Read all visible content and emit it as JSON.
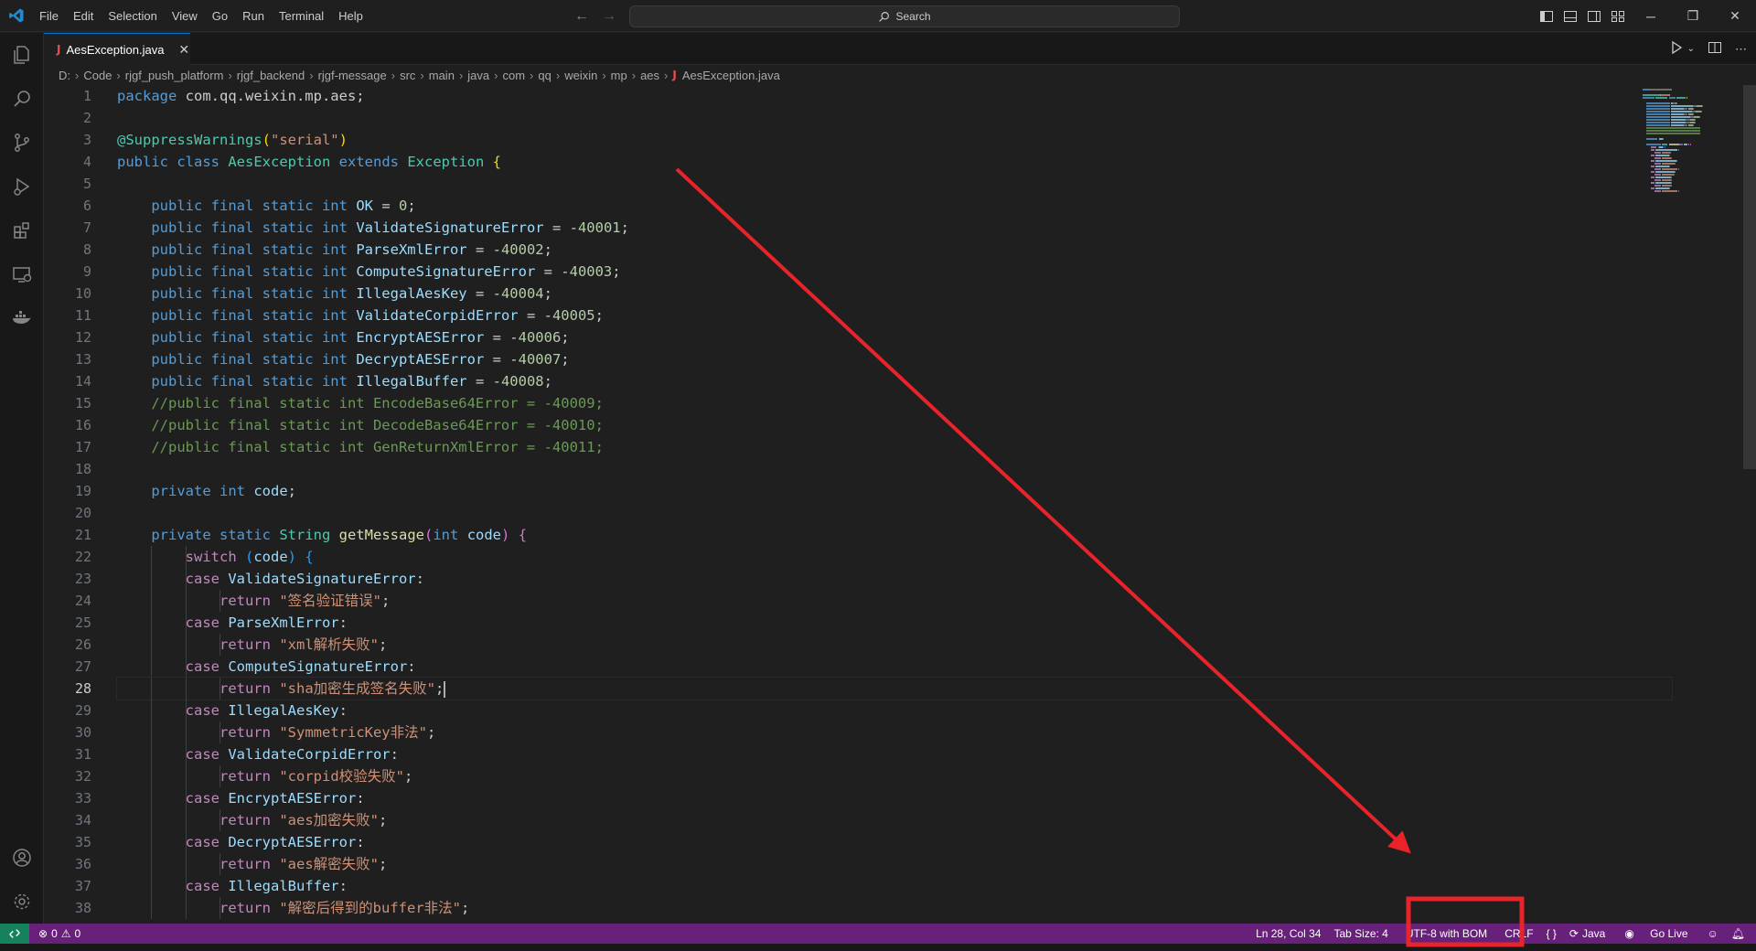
{
  "titlebar": {
    "menu": [
      "File",
      "Edit",
      "Selection",
      "View",
      "Go",
      "Run",
      "Terminal",
      "Help"
    ],
    "search_label": "Search"
  },
  "tab": {
    "icon_letter": "J",
    "filename": "AesException.java",
    "close": "✕"
  },
  "breadcrumb": {
    "items": [
      "D:",
      "Code",
      "rjgf_push_platform",
      "rjgf_backend",
      "rjgf-message",
      "src",
      "main",
      "java",
      "com",
      "qq",
      "weixin",
      "mp",
      "aes"
    ],
    "file": "AesException.java"
  },
  "editor": {
    "current_line": 28,
    "code": [
      [
        [
          "kw",
          "package"
        ],
        [
          "plain",
          " com.qq.weixin.mp.aes;"
        ]
      ],
      [],
      [
        [
          "ty",
          "@SuppressWarnings"
        ],
        [
          "br1",
          "("
        ],
        [
          "str",
          "\"serial\""
        ],
        [
          "br1",
          ")"
        ]
      ],
      [
        [
          "kw",
          "public class"
        ],
        [
          "plain",
          " "
        ],
        [
          "ty",
          "AesException"
        ],
        [
          "plain",
          " "
        ],
        [
          "kw",
          "extends"
        ],
        [
          "plain",
          " "
        ],
        [
          "ty",
          "Exception"
        ],
        [
          "plain",
          " "
        ],
        [
          "br1",
          "{"
        ]
      ],
      [],
      [
        [
          "plain",
          "    "
        ],
        [
          "kw",
          "public final static int"
        ],
        [
          "plain",
          " "
        ],
        [
          "var",
          "OK"
        ],
        [
          "plain",
          " = "
        ],
        [
          "num",
          "0"
        ],
        [
          "plain",
          ";"
        ]
      ],
      [
        [
          "plain",
          "    "
        ],
        [
          "kw",
          "public final static int"
        ],
        [
          "plain",
          " "
        ],
        [
          "var",
          "ValidateSignatureError"
        ],
        [
          "plain",
          " = -"
        ],
        [
          "num",
          "40001"
        ],
        [
          "plain",
          ";"
        ]
      ],
      [
        [
          "plain",
          "    "
        ],
        [
          "kw",
          "public final static int"
        ],
        [
          "plain",
          " "
        ],
        [
          "var",
          "ParseXmlError"
        ],
        [
          "plain",
          " = -"
        ],
        [
          "num",
          "40002"
        ],
        [
          "plain",
          ";"
        ]
      ],
      [
        [
          "plain",
          "    "
        ],
        [
          "kw",
          "public final static int"
        ],
        [
          "plain",
          " "
        ],
        [
          "var",
          "ComputeSignatureError"
        ],
        [
          "plain",
          " = -"
        ],
        [
          "num",
          "40003"
        ],
        [
          "plain",
          ";"
        ]
      ],
      [
        [
          "plain",
          "    "
        ],
        [
          "kw",
          "public final static int"
        ],
        [
          "plain",
          " "
        ],
        [
          "var",
          "IllegalAesKey"
        ],
        [
          "plain",
          " = -"
        ],
        [
          "num",
          "40004"
        ],
        [
          "plain",
          ";"
        ]
      ],
      [
        [
          "plain",
          "    "
        ],
        [
          "kw",
          "public final static int"
        ],
        [
          "plain",
          " "
        ],
        [
          "var",
          "ValidateCorpidError"
        ],
        [
          "plain",
          " = -"
        ],
        [
          "num",
          "40005"
        ],
        [
          "plain",
          ";"
        ]
      ],
      [
        [
          "plain",
          "    "
        ],
        [
          "kw",
          "public final static int"
        ],
        [
          "plain",
          " "
        ],
        [
          "var",
          "EncryptAESError"
        ],
        [
          "plain",
          " = -"
        ],
        [
          "num",
          "40006"
        ],
        [
          "plain",
          ";"
        ]
      ],
      [
        [
          "plain",
          "    "
        ],
        [
          "kw",
          "public final static int"
        ],
        [
          "plain",
          " "
        ],
        [
          "var",
          "DecryptAESError"
        ],
        [
          "plain",
          " = -"
        ],
        [
          "num",
          "40007"
        ],
        [
          "plain",
          ";"
        ]
      ],
      [
        [
          "plain",
          "    "
        ],
        [
          "kw",
          "public final static int"
        ],
        [
          "plain",
          " "
        ],
        [
          "var",
          "IllegalBuffer"
        ],
        [
          "plain",
          " = -"
        ],
        [
          "num",
          "40008"
        ],
        [
          "plain",
          ";"
        ]
      ],
      [
        [
          "plain",
          "    "
        ],
        [
          "cm",
          "//public final static int EncodeBase64Error = -40009;"
        ]
      ],
      [
        [
          "plain",
          "    "
        ],
        [
          "cm",
          "//public final static int DecodeBase64Error = -40010;"
        ]
      ],
      [
        [
          "plain",
          "    "
        ],
        [
          "cm",
          "//public final static int GenReturnXmlError = -40011;"
        ]
      ],
      [],
      [
        [
          "plain",
          "    "
        ],
        [
          "kw",
          "private int"
        ],
        [
          "plain",
          " "
        ],
        [
          "var",
          "code"
        ],
        [
          "plain",
          ";"
        ]
      ],
      [],
      [
        [
          "plain",
          "    "
        ],
        [
          "kw",
          "private static"
        ],
        [
          "plain",
          " "
        ],
        [
          "ty",
          "String"
        ],
        [
          "plain",
          " "
        ],
        [
          "fn",
          "getMessage"
        ],
        [
          "br2",
          "("
        ],
        [
          "kw",
          "int"
        ],
        [
          "plain",
          " "
        ],
        [
          "var",
          "code"
        ],
        [
          "br2",
          ")"
        ],
        [
          "plain",
          " "
        ],
        [
          "br2",
          "{"
        ]
      ],
      [
        [
          "plain",
          "        "
        ],
        [
          "ctl",
          "switch"
        ],
        [
          "plain",
          " "
        ],
        [
          "br3",
          "("
        ],
        [
          "var",
          "code"
        ],
        [
          "br3",
          ")"
        ],
        [
          "plain",
          " "
        ],
        [
          "br3",
          "{"
        ]
      ],
      [
        [
          "plain",
          "        "
        ],
        [
          "ctl",
          "case"
        ],
        [
          "plain",
          " "
        ],
        [
          "var",
          "ValidateSignatureError"
        ],
        [
          "plain",
          ":"
        ]
      ],
      [
        [
          "plain",
          "            "
        ],
        [
          "ctl",
          "return"
        ],
        [
          "plain",
          " "
        ],
        [
          "str",
          "\"签名验证错误\""
        ],
        [
          "plain",
          ";"
        ]
      ],
      [
        [
          "plain",
          "        "
        ],
        [
          "ctl",
          "case"
        ],
        [
          "plain",
          " "
        ],
        [
          "var",
          "ParseXmlError"
        ],
        [
          "plain",
          ":"
        ]
      ],
      [
        [
          "plain",
          "            "
        ],
        [
          "ctl",
          "return"
        ],
        [
          "plain",
          " "
        ],
        [
          "str",
          "\"xml解析失败\""
        ],
        [
          "plain",
          ";"
        ]
      ],
      [
        [
          "plain",
          "        "
        ],
        [
          "ctl",
          "case"
        ],
        [
          "plain",
          " "
        ],
        [
          "var",
          "ComputeSignatureError"
        ],
        [
          "plain",
          ":"
        ]
      ],
      [
        [
          "plain",
          "            "
        ],
        [
          "ctl",
          "return"
        ],
        [
          "plain",
          " "
        ],
        [
          "str",
          "\"sha加密生成签名失败\""
        ],
        [
          "plain",
          ";"
        ]
      ],
      [
        [
          "plain",
          "        "
        ],
        [
          "ctl",
          "case"
        ],
        [
          "plain",
          " "
        ],
        [
          "var",
          "IllegalAesKey"
        ],
        [
          "plain",
          ":"
        ]
      ],
      [
        [
          "plain",
          "            "
        ],
        [
          "ctl",
          "return"
        ],
        [
          "plain",
          " "
        ],
        [
          "str",
          "\"SymmetricKey非法\""
        ],
        [
          "plain",
          ";"
        ]
      ],
      [
        [
          "plain",
          "        "
        ],
        [
          "ctl",
          "case"
        ],
        [
          "plain",
          " "
        ],
        [
          "var",
          "ValidateCorpidError"
        ],
        [
          "plain",
          ":"
        ]
      ],
      [
        [
          "plain",
          "            "
        ],
        [
          "ctl",
          "return"
        ],
        [
          "plain",
          " "
        ],
        [
          "str",
          "\"corpid校验失败\""
        ],
        [
          "plain",
          ";"
        ]
      ],
      [
        [
          "plain",
          "        "
        ],
        [
          "ctl",
          "case"
        ],
        [
          "plain",
          " "
        ],
        [
          "var",
          "EncryptAESError"
        ],
        [
          "plain",
          ":"
        ]
      ],
      [
        [
          "plain",
          "            "
        ],
        [
          "ctl",
          "return"
        ],
        [
          "plain",
          " "
        ],
        [
          "str",
          "\"aes加密失败\""
        ],
        [
          "plain",
          ";"
        ]
      ],
      [
        [
          "plain",
          "        "
        ],
        [
          "ctl",
          "case"
        ],
        [
          "plain",
          " "
        ],
        [
          "var",
          "DecryptAESError"
        ],
        [
          "plain",
          ":"
        ]
      ],
      [
        [
          "plain",
          "            "
        ],
        [
          "ctl",
          "return"
        ],
        [
          "plain",
          " "
        ],
        [
          "str",
          "\"aes解密失败\""
        ],
        [
          "plain",
          ";"
        ]
      ],
      [
        [
          "plain",
          "        "
        ],
        [
          "ctl",
          "case"
        ],
        [
          "plain",
          " "
        ],
        [
          "var",
          "IllegalBuffer"
        ],
        [
          "plain",
          ":"
        ]
      ],
      [
        [
          "plain",
          "            "
        ],
        [
          "ctl",
          "return"
        ],
        [
          "plain",
          " "
        ],
        [
          "str",
          "\"解密后得到的buffer非法\""
        ],
        [
          "plain",
          ";"
        ]
      ]
    ]
  },
  "statusbar": {
    "errors": "0",
    "warnings": "0",
    "position": "Ln 28, Col 34",
    "tab_size": "Tab Size: 4",
    "encoding": "UTF-8 with BOM",
    "eol": "CRLF",
    "language": "Java",
    "go_live": "Go Live"
  },
  "colors": {
    "statusbar": "#68217a",
    "remote": "#16825d",
    "annotation": "#e8232a",
    "accent": "#0078d4"
  },
  "icons": {
    "activitybar": [
      "files-icon",
      "search-icon",
      "source-control-icon",
      "run-debug-icon",
      "extensions-icon",
      "remote-explorer-icon",
      "docker-icon"
    ],
    "activitybar_bottom": [
      "account-icon",
      "settings-gear-icon"
    ]
  }
}
